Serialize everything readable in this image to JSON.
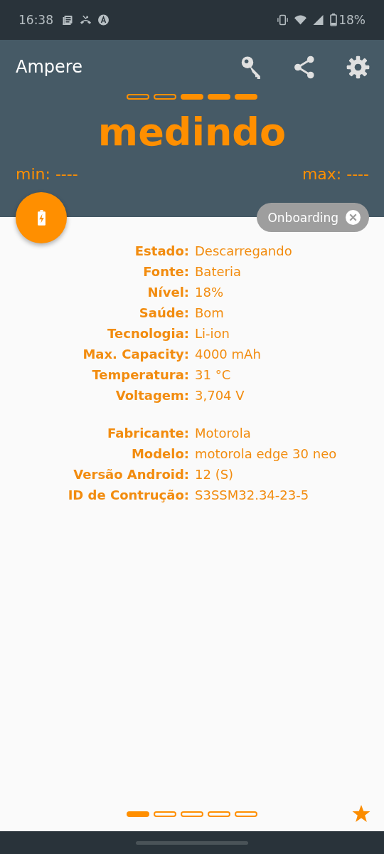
{
  "status_bar": {
    "time": "16:38",
    "battery": "18%"
  },
  "app_bar": {
    "title": "Ampere"
  },
  "meter": {
    "segments": [
      {
        "filled": false
      },
      {
        "filled": false
      },
      {
        "filled": true
      },
      {
        "filled": true
      },
      {
        "filled": true
      }
    ]
  },
  "reading": "medindo",
  "min": "min: ----",
  "max": "max: ----",
  "chip": {
    "label": "Onboarding"
  },
  "info_groups": [
    [
      {
        "label": "Estado:",
        "value": "Descarregando"
      },
      {
        "label": "Fonte:",
        "value": "Bateria"
      },
      {
        "label": "Nível:",
        "value": "18%"
      },
      {
        "label": "Saúde:",
        "value": "Bom"
      },
      {
        "label": "Tecnologia:",
        "value": "Li-ion"
      },
      {
        "label": "Max. Capacity:",
        "value": "4000 mAh"
      },
      {
        "label": "Temperatura:",
        "value": "31 °C"
      },
      {
        "label": "Voltagem:",
        "value": "3,704 V"
      }
    ],
    [
      {
        "label": "Fabricante:",
        "value": "Motorola"
      },
      {
        "label": "Modelo:",
        "value": "motorola edge 30 neo"
      },
      {
        "label": "Versão Android:",
        "value": "12 (S)"
      },
      {
        "label": "ID de Contrução:",
        "value": "S3SSM32.34-23-5"
      }
    ]
  ],
  "pager": [
    {
      "selected": true
    },
    {
      "selected": false
    },
    {
      "selected": false
    },
    {
      "selected": false
    },
    {
      "selected": false
    }
  ]
}
